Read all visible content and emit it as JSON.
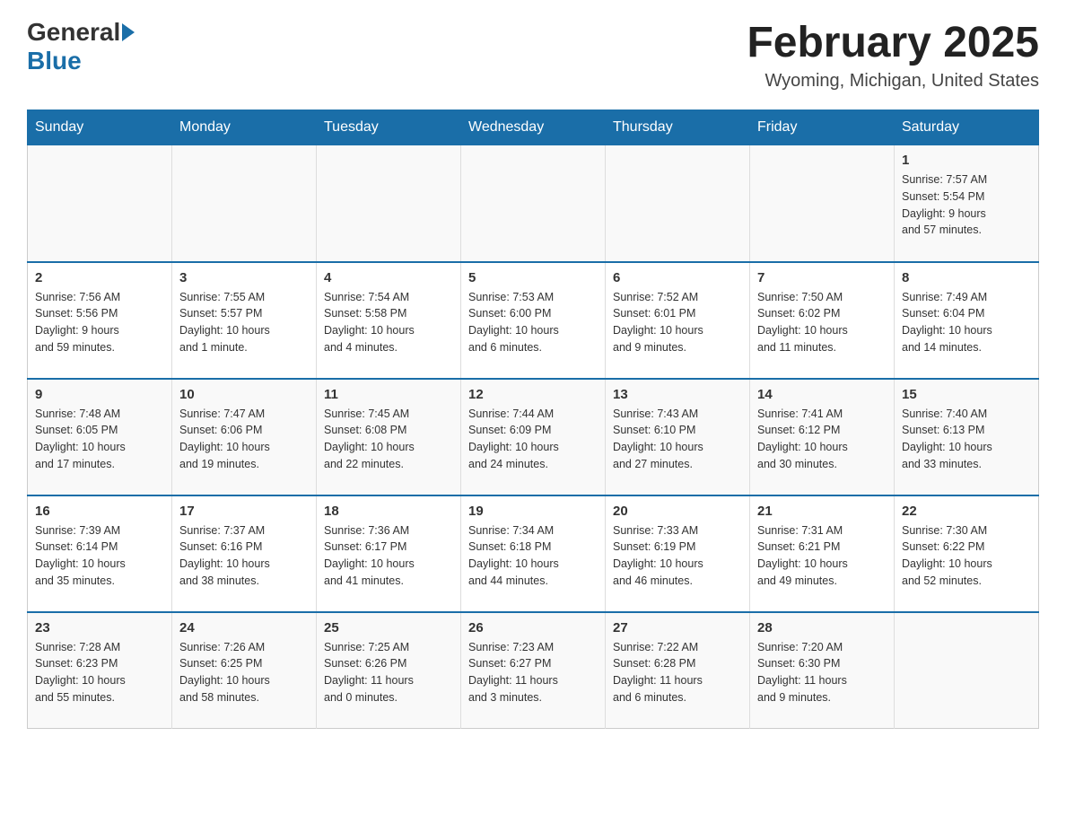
{
  "header": {
    "logo_general": "General",
    "logo_blue": "Blue",
    "month_title": "February 2025",
    "location": "Wyoming, Michigan, United States"
  },
  "days_of_week": [
    "Sunday",
    "Monday",
    "Tuesday",
    "Wednesday",
    "Thursday",
    "Friday",
    "Saturday"
  ],
  "weeks": [
    [
      {
        "day": "",
        "info": ""
      },
      {
        "day": "",
        "info": ""
      },
      {
        "day": "",
        "info": ""
      },
      {
        "day": "",
        "info": ""
      },
      {
        "day": "",
        "info": ""
      },
      {
        "day": "",
        "info": ""
      },
      {
        "day": "1",
        "info": "Sunrise: 7:57 AM\nSunset: 5:54 PM\nDaylight: 9 hours\nand 57 minutes."
      }
    ],
    [
      {
        "day": "2",
        "info": "Sunrise: 7:56 AM\nSunset: 5:56 PM\nDaylight: 9 hours\nand 59 minutes."
      },
      {
        "day": "3",
        "info": "Sunrise: 7:55 AM\nSunset: 5:57 PM\nDaylight: 10 hours\nand 1 minute."
      },
      {
        "day": "4",
        "info": "Sunrise: 7:54 AM\nSunset: 5:58 PM\nDaylight: 10 hours\nand 4 minutes."
      },
      {
        "day": "5",
        "info": "Sunrise: 7:53 AM\nSunset: 6:00 PM\nDaylight: 10 hours\nand 6 minutes."
      },
      {
        "day": "6",
        "info": "Sunrise: 7:52 AM\nSunset: 6:01 PM\nDaylight: 10 hours\nand 9 minutes."
      },
      {
        "day": "7",
        "info": "Sunrise: 7:50 AM\nSunset: 6:02 PM\nDaylight: 10 hours\nand 11 minutes."
      },
      {
        "day": "8",
        "info": "Sunrise: 7:49 AM\nSunset: 6:04 PM\nDaylight: 10 hours\nand 14 minutes."
      }
    ],
    [
      {
        "day": "9",
        "info": "Sunrise: 7:48 AM\nSunset: 6:05 PM\nDaylight: 10 hours\nand 17 minutes."
      },
      {
        "day": "10",
        "info": "Sunrise: 7:47 AM\nSunset: 6:06 PM\nDaylight: 10 hours\nand 19 minutes."
      },
      {
        "day": "11",
        "info": "Sunrise: 7:45 AM\nSunset: 6:08 PM\nDaylight: 10 hours\nand 22 minutes."
      },
      {
        "day": "12",
        "info": "Sunrise: 7:44 AM\nSunset: 6:09 PM\nDaylight: 10 hours\nand 24 minutes."
      },
      {
        "day": "13",
        "info": "Sunrise: 7:43 AM\nSunset: 6:10 PM\nDaylight: 10 hours\nand 27 minutes."
      },
      {
        "day": "14",
        "info": "Sunrise: 7:41 AM\nSunset: 6:12 PM\nDaylight: 10 hours\nand 30 minutes."
      },
      {
        "day": "15",
        "info": "Sunrise: 7:40 AM\nSunset: 6:13 PM\nDaylight: 10 hours\nand 33 minutes."
      }
    ],
    [
      {
        "day": "16",
        "info": "Sunrise: 7:39 AM\nSunset: 6:14 PM\nDaylight: 10 hours\nand 35 minutes."
      },
      {
        "day": "17",
        "info": "Sunrise: 7:37 AM\nSunset: 6:16 PM\nDaylight: 10 hours\nand 38 minutes."
      },
      {
        "day": "18",
        "info": "Sunrise: 7:36 AM\nSunset: 6:17 PM\nDaylight: 10 hours\nand 41 minutes."
      },
      {
        "day": "19",
        "info": "Sunrise: 7:34 AM\nSunset: 6:18 PM\nDaylight: 10 hours\nand 44 minutes."
      },
      {
        "day": "20",
        "info": "Sunrise: 7:33 AM\nSunset: 6:19 PM\nDaylight: 10 hours\nand 46 minutes."
      },
      {
        "day": "21",
        "info": "Sunrise: 7:31 AM\nSunset: 6:21 PM\nDaylight: 10 hours\nand 49 minutes."
      },
      {
        "day": "22",
        "info": "Sunrise: 7:30 AM\nSunset: 6:22 PM\nDaylight: 10 hours\nand 52 minutes."
      }
    ],
    [
      {
        "day": "23",
        "info": "Sunrise: 7:28 AM\nSunset: 6:23 PM\nDaylight: 10 hours\nand 55 minutes."
      },
      {
        "day": "24",
        "info": "Sunrise: 7:26 AM\nSunset: 6:25 PM\nDaylight: 10 hours\nand 58 minutes."
      },
      {
        "day": "25",
        "info": "Sunrise: 7:25 AM\nSunset: 6:26 PM\nDaylight: 11 hours\nand 0 minutes."
      },
      {
        "day": "26",
        "info": "Sunrise: 7:23 AM\nSunset: 6:27 PM\nDaylight: 11 hours\nand 3 minutes."
      },
      {
        "day": "27",
        "info": "Sunrise: 7:22 AM\nSunset: 6:28 PM\nDaylight: 11 hours\nand 6 minutes."
      },
      {
        "day": "28",
        "info": "Sunrise: 7:20 AM\nSunset: 6:30 PM\nDaylight: 11 hours\nand 9 minutes."
      },
      {
        "day": "",
        "info": ""
      }
    ]
  ]
}
